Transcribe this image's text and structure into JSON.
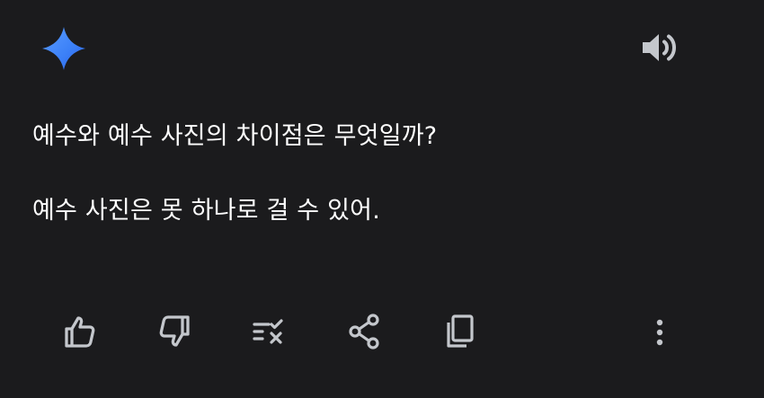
{
  "header": {
    "logo_icon": "gemini-sparkle-icon",
    "speaker_icon": "volume-up-icon",
    "logo_colors": [
      "#4a8cf7",
      "#2b6ef2"
    ]
  },
  "message": {
    "lines": [
      "예수와 예수 사진의 차이점은 무엇일까?",
      "예수 사진은 못 하나로 걸 수 있어."
    ]
  },
  "actions": {
    "items": [
      {
        "name": "thumbs-up",
        "icon": "thumbs-up-icon"
      },
      {
        "name": "thumbs-down",
        "icon": "thumbs-down-icon"
      },
      {
        "name": "modify-response",
        "icon": "tune-check-icon"
      },
      {
        "name": "share",
        "icon": "share-icon"
      },
      {
        "name": "copy",
        "icon": "copy-icon"
      },
      {
        "name": "more-options",
        "icon": "more-vertical-icon"
      }
    ]
  },
  "colors": {
    "background": "#1b1b1d",
    "text": "#ffffff",
    "icon": "#c4c7cc"
  }
}
